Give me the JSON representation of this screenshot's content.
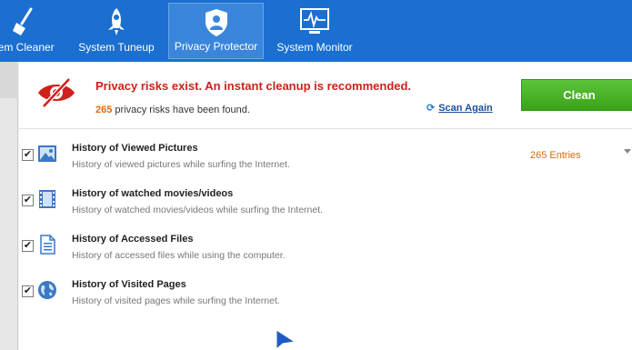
{
  "nav": {
    "tabs": [
      {
        "label": "tem Cleaner",
        "icon": "broom-icon"
      },
      {
        "label": "System Tuneup",
        "icon": "rocket-icon"
      },
      {
        "label": "Privacy Protector",
        "icon": "shield-user-icon"
      },
      {
        "label": "System Monitor",
        "icon": "monitor-pulse-icon"
      }
    ],
    "active": "Privacy Protector"
  },
  "banner": {
    "title": "Privacy risks exist. An instant cleanup is recommended.",
    "count": "265",
    "subtitle": "privacy risks have been found.",
    "scan_again": "Scan Again",
    "clean": "Clean"
  },
  "items": [
    {
      "title": "History of Viewed Pictures",
      "desc": "History of viewed pictures while surfing the Internet.",
      "entries": "265 Entries",
      "checked": true,
      "icon": "picture-icon"
    },
    {
      "title": "History of watched movies/videos",
      "desc": "History of watched movies/videos while surfing the Internet.",
      "entries": "",
      "checked": true,
      "icon": "film-icon"
    },
    {
      "title": "History of Accessed Files",
      "desc": "History of accessed files while using the computer.",
      "entries": "",
      "checked": true,
      "icon": "document-icon"
    },
    {
      "title": "History of Visited Pages",
      "desc": "History of visited pages while surfing the Internet.",
      "entries": "",
      "checked": true,
      "icon": "globe-icon"
    }
  ],
  "colors": {
    "topbar": "#1a6fd0",
    "risk_red": "#d0201c",
    "count_orange": "#e06b0c",
    "clean_green": "#3aa317"
  }
}
